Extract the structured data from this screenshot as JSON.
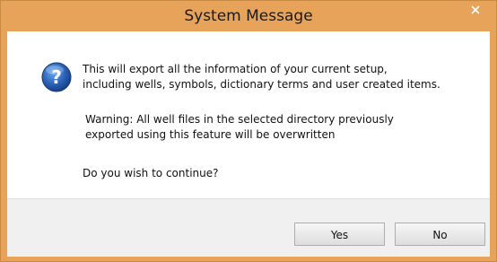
{
  "window": {
    "title": "System Message",
    "close_label": "×"
  },
  "dialog": {
    "icon": "question-icon",
    "message_lines": [
      "This will export all the information of your current setup,",
      "including wells, symbols, dictionary terms and user created items."
    ],
    "warning_lines": [
      "Warning: All well files in the selected directory previously",
      "exported using this feature will be overwritten"
    ],
    "question": "Do you wish to continue?"
  },
  "buttons": {
    "yes_label": "Yes",
    "no_label": "No"
  },
  "colors": {
    "title_bar": "#e8a35a",
    "button_bar": "#f0f0f0",
    "icon_blue": "#2a63b8"
  }
}
